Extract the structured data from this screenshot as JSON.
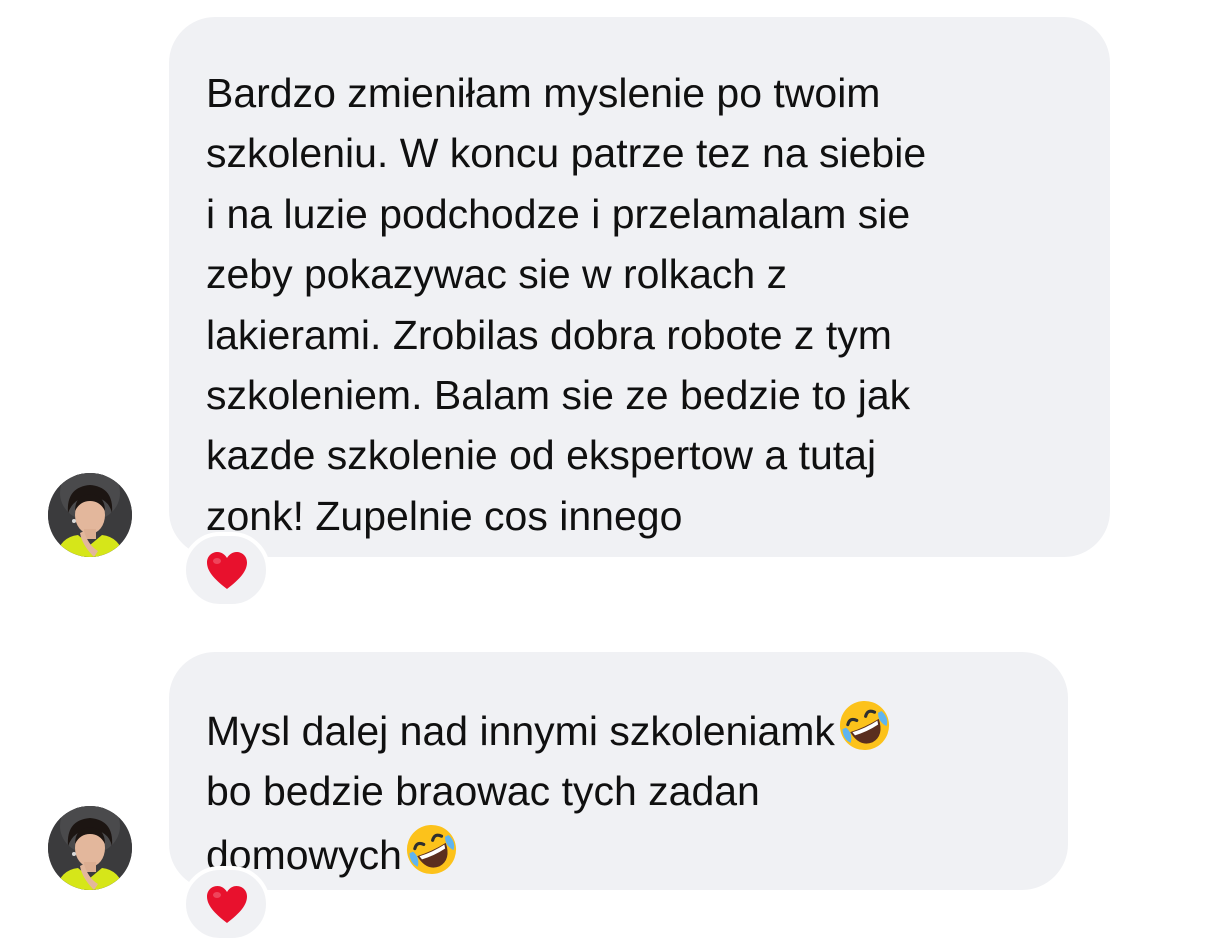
{
  "conversation": {
    "messages": [
      {
        "lines": [
          "Bardzo zmieniłam myslenie po twoim",
          "szkoleniu. W koncu patrze tez na siebie",
          "i na luzie podchodze i przelamalam sie",
          "zeby pokazywac sie w rolkach z",
          "lakierami. Zrobilas dobra robote z tym",
          "szkoleniem. Balam sie ze bedzie to jak",
          "kazde szkolenie od ekspertow a tutaj",
          "zonk! Zupelnie cos innego"
        ],
        "reaction": "heart-reaction",
        "avatar": "user-avatar"
      },
      {
        "lines": [
          "Mysl dalej nad innymi szkoleniamk",
          "bo bedzie braowac tych zadan",
          "domowych"
        ],
        "inline_emojis": [
          "rolling-on-the-floor-laughing-emoji",
          "rolling-on-the-floor-laughing-emoji"
        ],
        "reaction": "heart-reaction",
        "avatar": "user-avatar"
      }
    ]
  },
  "colors": {
    "background": "#ffffff",
    "bubble": "#f0f1f4",
    "text": "#101010",
    "heart": "#e8112d",
    "avatar_jacket": "#d6e619"
  }
}
